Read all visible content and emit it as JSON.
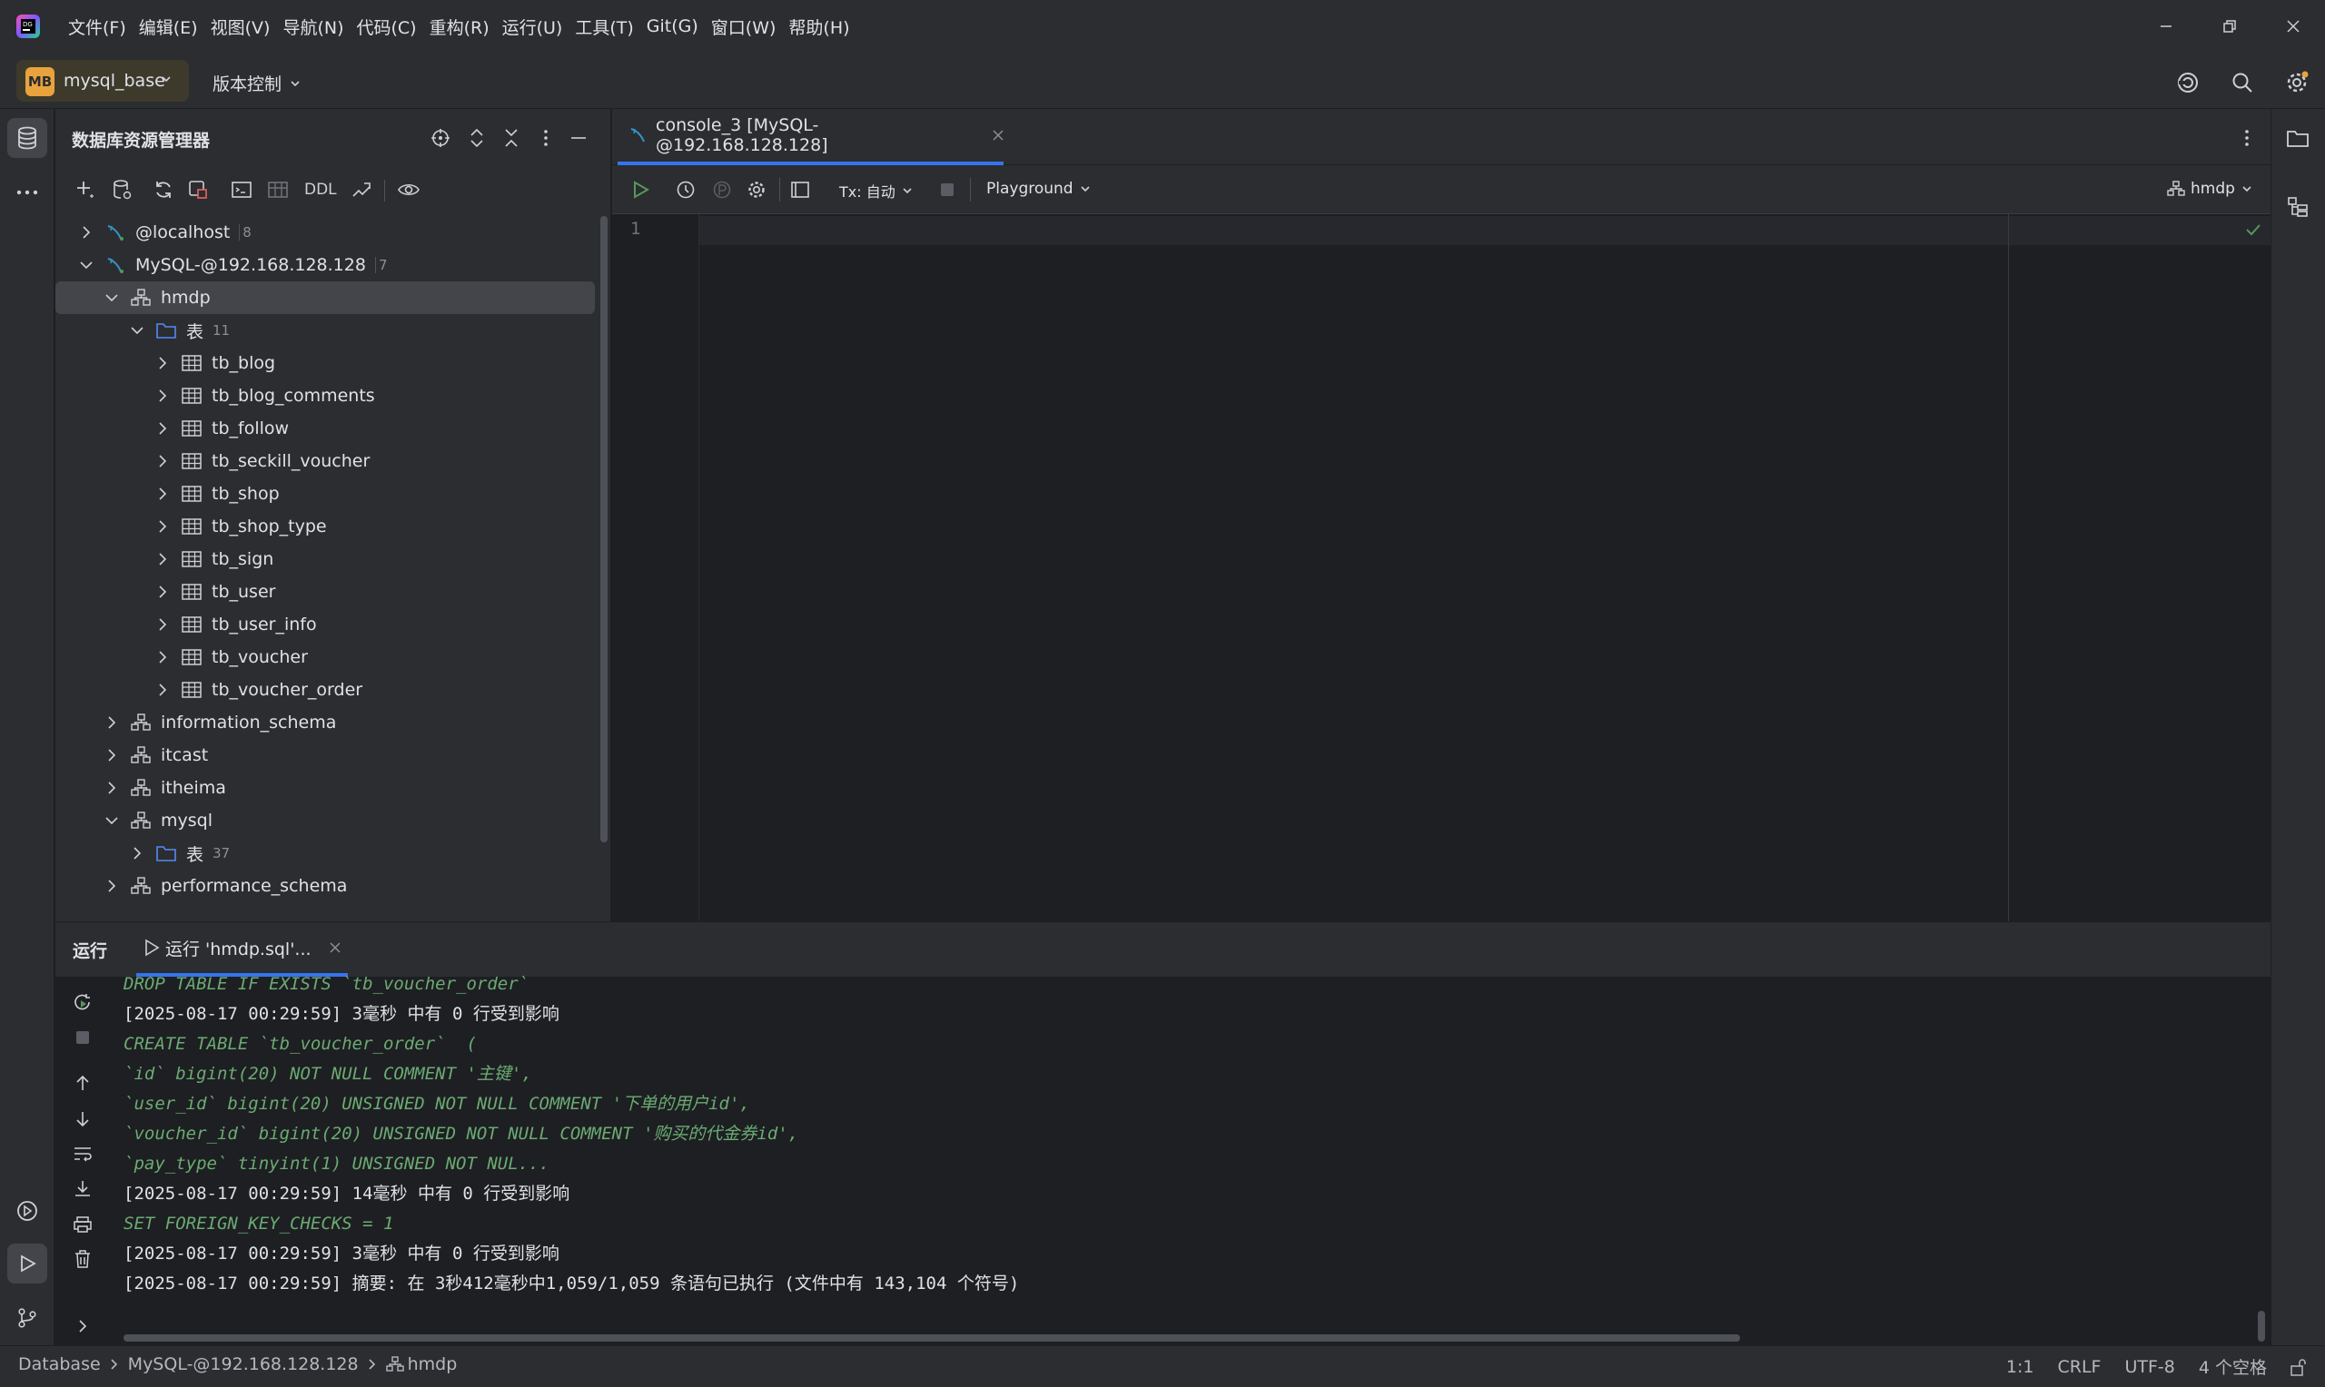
{
  "menu": [
    "文件(F)",
    "编辑(E)",
    "视图(V)",
    "导航(N)",
    "代码(C)",
    "重构(R)",
    "运行(U)",
    "工具(T)",
    "Git(G)",
    "窗口(W)",
    "帮助(H)"
  ],
  "project": {
    "badge": "MB",
    "name": "mysql_base",
    "vcs": "版本控制"
  },
  "db_panel": {
    "title": "数据库资源管理器",
    "ddl_label": "DDL",
    "tree": [
      {
        "label": "@localhost",
        "count": "8",
        "kind": "datasource",
        "level": 0,
        "expanded": false
      },
      {
        "label": "MySQL-@192.168.128.128",
        "count": "7",
        "kind": "datasource",
        "level": 0,
        "expanded": true
      },
      {
        "label": "hmdp",
        "count": "",
        "kind": "schema",
        "level": 1,
        "expanded": true,
        "selected": true
      },
      {
        "label": "表",
        "count": "11",
        "kind": "folder",
        "level": 2,
        "expanded": true
      },
      {
        "label": "tb_blog",
        "count": "",
        "kind": "table",
        "level": 3,
        "expanded": false
      },
      {
        "label": "tb_blog_comments",
        "count": "",
        "kind": "table",
        "level": 3,
        "expanded": false
      },
      {
        "label": "tb_follow",
        "count": "",
        "kind": "table",
        "level": 3,
        "expanded": false
      },
      {
        "label": "tb_seckill_voucher",
        "count": "",
        "kind": "table",
        "level": 3,
        "expanded": false
      },
      {
        "label": "tb_shop",
        "count": "",
        "kind": "table",
        "level": 3,
        "expanded": false
      },
      {
        "label": "tb_shop_type",
        "count": "",
        "kind": "table",
        "level": 3,
        "expanded": false
      },
      {
        "label": "tb_sign",
        "count": "",
        "kind": "table",
        "level": 3,
        "expanded": false
      },
      {
        "label": "tb_user",
        "count": "",
        "kind": "table",
        "level": 3,
        "expanded": false
      },
      {
        "label": "tb_user_info",
        "count": "",
        "kind": "table",
        "level": 3,
        "expanded": false
      },
      {
        "label": "tb_voucher",
        "count": "",
        "kind": "table",
        "level": 3,
        "expanded": false
      },
      {
        "label": "tb_voucher_order",
        "count": "",
        "kind": "table",
        "level": 3,
        "expanded": false
      },
      {
        "label": "information_schema",
        "count": "",
        "kind": "schema",
        "level": 1,
        "expanded": false
      },
      {
        "label": "itcast",
        "count": "",
        "kind": "schema",
        "level": 1,
        "expanded": false
      },
      {
        "label": "itheima",
        "count": "",
        "kind": "schema",
        "level": 1,
        "expanded": false
      },
      {
        "label": "mysql",
        "count": "",
        "kind": "schema",
        "level": 1,
        "expanded": true
      },
      {
        "label": "表",
        "count": "37",
        "kind": "folder",
        "level": 2,
        "expanded": false
      },
      {
        "label": "performance_schema",
        "count": "",
        "kind": "schema",
        "level": 1,
        "expanded": false
      }
    ]
  },
  "editor": {
    "tab_label": "console_3 [MySQL-@192.168.128.128]",
    "tx_label": "Tx: 自动",
    "playground_label": "Playground",
    "schema_label": "hmdp",
    "line_number": "1"
  },
  "run": {
    "title": "运行",
    "tab_label": "运行 'hmdp.sql'...",
    "lines": [
      {
        "type": "sql",
        "text": "DROP TABLE IF EXISTS `tb_voucher_order`"
      },
      {
        "type": "log",
        "text": "[2025-08-17 00:29:59] 3毫秒 中有 0 行受到影响"
      },
      {
        "type": "sql",
        "text": "CREATE TABLE `tb_voucher_order`  ("
      },
      {
        "type": "sql",
        "text": "`id` bigint(20) NOT NULL COMMENT '主键',"
      },
      {
        "type": "sql",
        "text": "`user_id` bigint(20) UNSIGNED NOT NULL COMMENT '下单的用户id',"
      },
      {
        "type": "sql",
        "text": "`voucher_id` bigint(20) UNSIGNED NOT NULL COMMENT '购买的代金券id',"
      },
      {
        "type": "sql",
        "text": "`pay_type` tinyint(1) UNSIGNED NOT NUL..."
      },
      {
        "type": "log",
        "text": "[2025-08-17 00:29:59] 14毫秒 中有 0 行受到影响"
      },
      {
        "type": "sql",
        "text": "SET FOREIGN_KEY_CHECKS = 1"
      },
      {
        "type": "log",
        "text": "[2025-08-17 00:29:59] 3毫秒 中有 0 行受到影响"
      },
      {
        "type": "log",
        "text": "[2025-08-17 00:29:59] 摘要: 在 3秒412毫秒中1,059/1,059 条语句已执行 (文件中有 143,104 个符号)"
      }
    ]
  },
  "status": {
    "breadcrumb": [
      "Database",
      "MySQL-@192.168.128.128",
      "hmdp"
    ],
    "position": "1:1",
    "line_sep": "CRLF",
    "encoding": "UTF-8",
    "indent": "4 个空格"
  },
  "colors": {
    "accent": "#3574f0",
    "run_green": "#57965c",
    "sql_text": "#6aab73",
    "badge": "#e8a33d",
    "selected_row": "#43454a"
  }
}
